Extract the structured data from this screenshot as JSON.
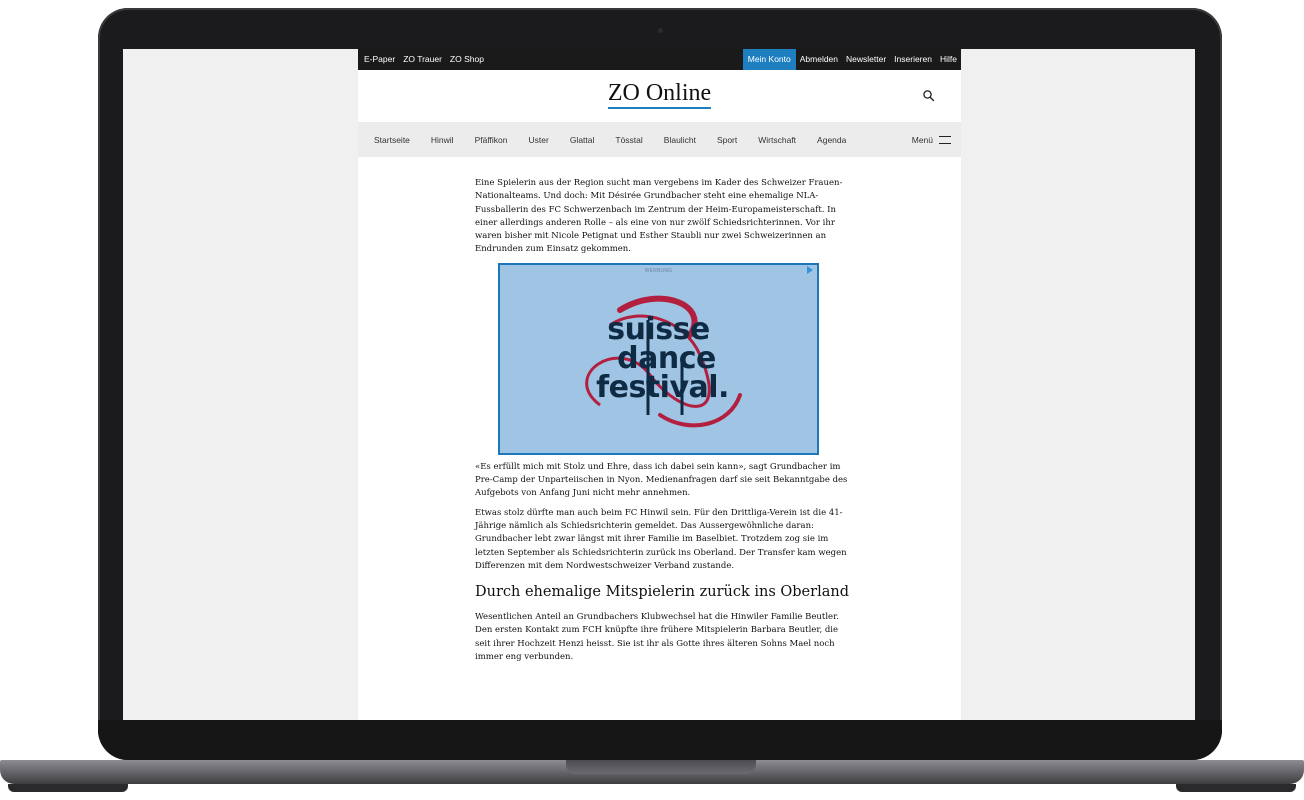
{
  "topbar": {
    "left_links": [
      "E-Paper",
      "ZO Trauer",
      "ZO Shop"
    ],
    "account": "Mein Konto",
    "right_links": [
      "Abmelden",
      "Newsletter",
      "Inserieren",
      "Hilfe"
    ]
  },
  "masthead": {
    "logo": "ZO Online"
  },
  "nav": {
    "items": [
      "Startseite",
      "Hinwil",
      "Pfäffikon",
      "Uster",
      "Glattal",
      "Tösstal",
      "Blaulicht",
      "Sport",
      "Wirtschaft",
      "Agenda"
    ],
    "menu_label": "Menü"
  },
  "article": {
    "p1": "Eine Spielerin aus der Region sucht man vergebens im Kader des Schweizer Frauen-Nationalteams. Und doch: Mit Désirée Grundbacher steht eine ehemalige NLA-Fussballerin des FC Schwerzenbach im Zentrum der Heim-Europameisterschaft. In einer allerdings anderen Rolle – als eine von nur zwölf Schiedsrichterinnen. Vor ihr waren bisher mit Nicole Petignat und Esther Staubli nur zwei Schweizerinnen an Endrunden zum Einsatz gekommen.",
    "p2": "«Es erfüllt mich mit Stolz und Ehre, dass ich dabei sein kann», sagt Grundbacher im Pre-Camp der Unparteiischen in Nyon. Medienanfragen darf sie seit Bekanntgabe des Aufgebots von Anfang Juni nicht mehr annehmen.",
    "p3": "Etwas stolz dürfte man auch beim FC Hinwil sein. Für den Drittliga-Verein ist die 41-Jährige nämlich als Schiedsrichterin gemeldet. Das Aussergewöhnliche daran: Grundbacher lebt zwar längst mit ihrer Familie im Baselbiet. Trotzdem zog sie im letzten September als Schiedsrichterin zurück ins Oberland. Der Transfer kam wegen Differenzen mit dem Nordwestschweizer Verband zustande.",
    "subhead": "Durch ehemalige Mitspielerin zurück ins Oberland",
    "p4": "Wesentlichen Anteil an Grundbachers Klubwechsel hat die Hinwiler Familie Beutler. Den ersten Kontakt zum FCH knüpfte ihre frühere Mitspielerin Barbara Beutler, die seit ihrer Hochzeit Henzi heisst. Sie ist ihr als Gotte ihres älteren Sohns Mael noch immer eng verbunden."
  },
  "ad": {
    "label": "WERBUNG",
    "lines": [
      "suisse",
      "dance",
      "festival."
    ],
    "colors": {
      "background": "#9fc4e4",
      "text": "#0f2a43",
      "ribbon": "#b3203f",
      "border": "#1c78b8"
    }
  },
  "colors": {
    "accent": "#1e7fc0",
    "topbar": "#1a1a1a",
    "nav_bg": "#ececec"
  }
}
